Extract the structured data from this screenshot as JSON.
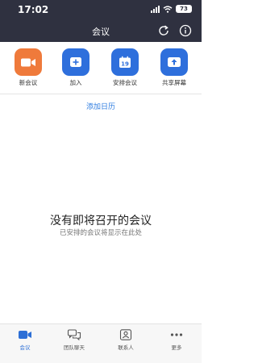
{
  "status_bar": {
    "time": "17:02",
    "battery": "73"
  },
  "nav": {
    "title": "会议"
  },
  "actions": [
    {
      "label": "新会议",
      "icon": "video-camera-icon",
      "color": "#ef7a3b"
    },
    {
      "label": "加入",
      "icon": "plus-icon",
      "color": "#2e6fdc"
    },
    {
      "label": "安排会议",
      "icon": "calendar-icon",
      "color": "#2e6fdc",
      "badge": "19"
    },
    {
      "label": "共享屏幕",
      "icon": "share-screen-icon",
      "color": "#2e6fdc"
    }
  ],
  "calendar_link": "添加日历",
  "empty_state": {
    "title": "没有即将召开的会议",
    "subtitle": "已安排的会议将显示在此处"
  },
  "tabs": [
    {
      "label": "会议",
      "icon": "video-camera-icon",
      "active": true
    },
    {
      "label": "团队聊天",
      "icon": "chat-bubbles-icon"
    },
    {
      "label": "联系人",
      "icon": "contacts-icon"
    },
    {
      "label": "更多",
      "icon": "more-dots-icon"
    }
  ],
  "colors": {
    "accent": "#2e6fdc",
    "new_meeting": "#ef7a3b",
    "header_bg": "#2f3140",
    "link": "#2e7ce0"
  }
}
